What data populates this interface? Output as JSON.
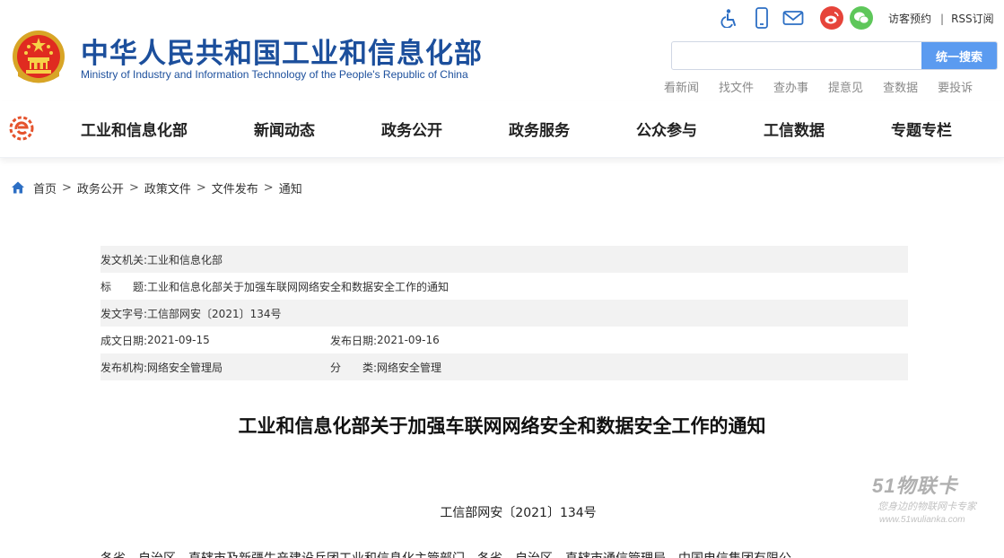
{
  "header": {
    "site_title": "中华人民共和国工业和信息化部",
    "site_subtitle": "Ministry of Industry and Information Technology of the People's Republic of China",
    "icons": [
      "accessibility-icon",
      "mobile-icon",
      "mail-icon",
      "weibo-icon",
      "wechat-icon"
    ],
    "top_links": {
      "visitor_booking": "访客预约",
      "separator": "|",
      "rss": "RSS订阅"
    },
    "search": {
      "placeholder": "",
      "button": "统一搜索"
    },
    "quick_links": [
      "看新闻",
      "找文件",
      "查办事",
      "提意见",
      "查数据",
      "要投诉"
    ]
  },
  "nav": {
    "items": [
      "工业和信息化部",
      "新闻动态",
      "政务公开",
      "政务服务",
      "公众参与",
      "工信数据",
      "专题专栏"
    ]
  },
  "breadcrumb": {
    "items": [
      "首页",
      "政务公开",
      "政策文件",
      "文件发布",
      "通知"
    ],
    "separator": ">"
  },
  "meta": {
    "issuer_label": "发文机关:",
    "issuer": "工业和信息化部",
    "title_label": "标　　题:",
    "title": "工业和信息化部关于加强车联网网络安全和数据安全工作的通知",
    "doc_no_label": "发文字号:",
    "doc_no": "工信部网安〔2021〕134号",
    "created_label": "成文日期:",
    "created": "2021-09-15",
    "published_label": "发布日期:",
    "published": "2021-09-16",
    "org_label": "发布机构:",
    "org": "网络安全管理局",
    "category_label": "分　　类:",
    "category": "网络安全管理"
  },
  "article": {
    "title": "工业和信息化部关于加强车联网网络安全和数据安全工作的通知",
    "doc_number": "工信部网安〔2021〕134号",
    "first_line": "各省、自治区、直辖市及新疆生产建设兵团工业和信息化主管部门，各省、自治区、直辖市通信管理局，中国电信集团有限公"
  },
  "watermark": {
    "brand": "51物联卡",
    "slogan": "您身边的物联网卡专家",
    "url": "www.51wulianka.com"
  },
  "colors": {
    "brand_blue": "#1c4f9c",
    "search_button": "#5b9bf0",
    "meta_shade": "#f2f2f2",
    "weibo_red": "#e6443a",
    "wechat_green": "#5ec75a"
  }
}
